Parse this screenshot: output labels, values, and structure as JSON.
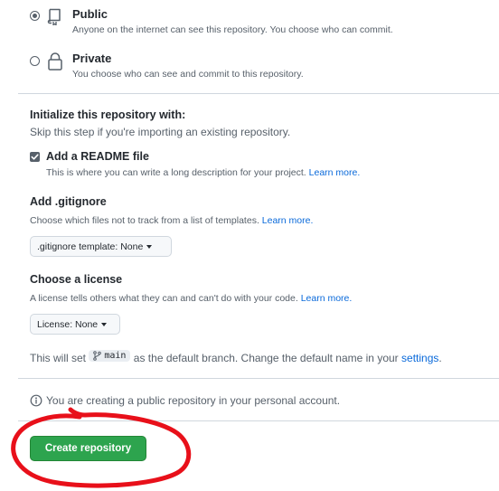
{
  "visibility": {
    "options": [
      {
        "label": "Public",
        "description": "Anyone on the internet can see this repository. You choose who can commit.",
        "checked": true,
        "icon": "repo-icon"
      },
      {
        "label": "Private",
        "description": "You choose who can see and commit to this repository.",
        "checked": false,
        "icon": "lock-icon"
      }
    ]
  },
  "init": {
    "title": "Initialize this repository with:",
    "subtitle": "Skip this step if you're importing an existing repository.",
    "readme": {
      "label": "Add a README file",
      "description": "This is where you can write a long description for your project.",
      "link": "Learn more.",
      "checked": true
    }
  },
  "gitignore": {
    "title": "Add .gitignore",
    "description": "Choose which files not to track from a list of templates.",
    "link": "Learn more.",
    "button": ".gitignore template: None"
  },
  "license": {
    "title": "Choose a license",
    "description": "A license tells others what they can and can't do with your code.",
    "link": "Learn more.",
    "button": "License: None"
  },
  "branch": {
    "prefix": "This will set",
    "name": "main",
    "middle": "as the default branch. Change the default name in your",
    "link": "settings",
    "suffix": "."
  },
  "notice": {
    "text": "You are creating a public repository in your personal account."
  },
  "submit": {
    "label": "Create repository"
  },
  "colors": {
    "primary_button": "#2da44e",
    "link": "#0969da",
    "annotation": "#e8101a"
  }
}
